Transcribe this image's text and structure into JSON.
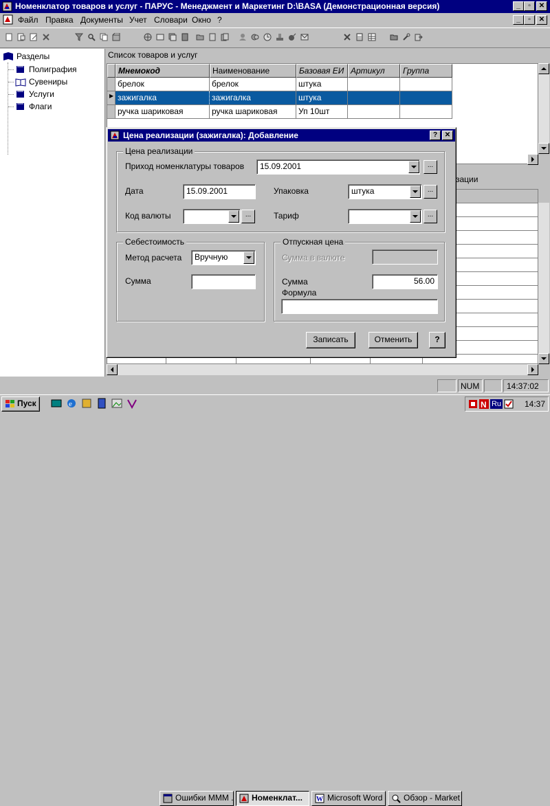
{
  "window": {
    "title": "Номенклатор товаров и услуг - ПАРУС - Менеджмент и Маркетинг  D:\\BASA (Демонстрационная версия)"
  },
  "menu": {
    "items": [
      "Файл",
      "Правка",
      "Документы",
      "Учет",
      "Словари",
      "Окно",
      "?"
    ]
  },
  "tree": {
    "root": "Разделы",
    "items": [
      "Полиграфия",
      "Сувениры",
      "Услуги",
      "Флаги"
    ]
  },
  "list": {
    "title": "Список товаров и услуг",
    "columns": [
      "Мнемокод",
      "Наименование",
      "Базовая ЕИ",
      "Артикул",
      "Группа"
    ],
    "rows": [
      [
        "брелок",
        "брелок",
        "штука",
        "",
        ""
      ],
      [
        "зажигалка",
        "зажигалка",
        "штука",
        "",
        ""
      ],
      [
        "ручка шариковая",
        "ручка шариковая",
        "Уп 10шт",
        "",
        ""
      ]
    ],
    "selected_row": 1
  },
  "lower_panel": {
    "partial_title": "зации"
  },
  "dialog": {
    "title": "Цена реализации (зажигалка): Добавление",
    "group_price": "Цена реализации",
    "label_receipt": "Приход номенклатуры товаров",
    "value_receipt": "15.09.2001",
    "label_date": "Дата",
    "value_date": "15.09.2001",
    "label_package": "Упаковка",
    "value_package": "штука",
    "label_currency": "Код валюты",
    "value_currency": "",
    "label_tariff": "Тариф",
    "value_tariff": "",
    "group_cost": "Себестоимость",
    "label_method": "Метод расчета",
    "value_method": "Вручную",
    "label_sum_cost": "Сумма",
    "value_sum_cost": "",
    "group_sale": "Отпускная цена",
    "label_sum_currency": "Сумма в валюте",
    "value_sum_currency": "",
    "label_sum_sale": "Сумма",
    "value_sum_sale": "56.00",
    "label_formula": "Формула",
    "value_formula": "",
    "btn_save": "Записать",
    "btn_cancel": "Отменить",
    "btn_help": "?",
    "dots": "..."
  },
  "statusbar": {
    "num": "NUM",
    "time": "14:37:02"
  },
  "taskbar": {
    "start": "Пуск",
    "tasks": [
      "Ошибки МММ ...",
      "Номенклат...",
      "Microsoft Word ...",
      "Обзор - Market"
    ],
    "active_task": 1,
    "tray_lang": "Ru",
    "clock": "14:37"
  },
  "colors": {
    "title_bar": "#000080",
    "selection": "#0a5aa0",
    "desktop_gray": "#c0c0c0"
  }
}
